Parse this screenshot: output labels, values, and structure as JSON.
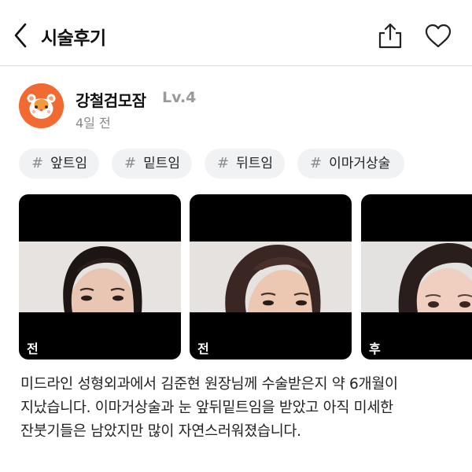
{
  "header": {
    "title": "시술후기",
    "back_icon": "chevron-left-icon",
    "share_icon": "share-icon",
    "like_icon": "heart-outline-icon"
  },
  "author": {
    "name": "강철검모잠",
    "level": "Lv.4",
    "time": "4일 전",
    "avatar_icon": "hamster-avatar-icon",
    "avatar_color": "#f06a32"
  },
  "tags": [
    "앞트임",
    "밑트임",
    "뒤트임",
    "이마거상술"
  ],
  "photos": [
    {
      "label": "전",
      "subject": "woman-face-before-1"
    },
    {
      "label": "전",
      "subject": "woman-face-before-2"
    },
    {
      "label": "후",
      "subject": "woman-face-after"
    }
  ],
  "post": {
    "lines": [
      "미드라인 성형외과에서 김준현 원장님께 수술받은지 약 6개월이",
      "지났습니다. 이마거상술과 눈 앞뒤밑트임을 받았고 아직 미세한",
      "잔붓기들은 남았지만 많이 자연스러워졌습니다."
    ]
  }
}
